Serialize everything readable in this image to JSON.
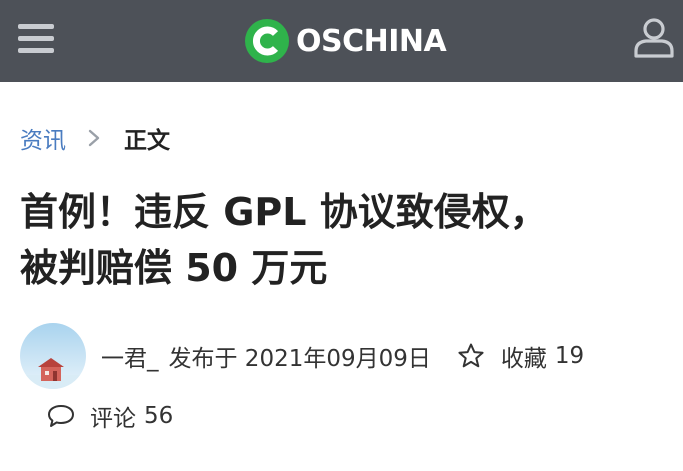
{
  "header": {
    "brand": "OSCHINA",
    "colors": {
      "bar": "#4d5158",
      "logo_green": "#2fb34b"
    },
    "icons": {
      "menu": "hamburger-menu-icon",
      "user": "user-icon",
      "logo": "oschina-logo-icon"
    }
  },
  "breadcrumb": {
    "parent": "资讯",
    "current": "正文",
    "separator_icon": "chevron-right-icon",
    "link_color": "#4a7cc0"
  },
  "article": {
    "title_line1": "首例！违反 GPL 协议致侵权，",
    "title_line2": "被判赔偿 50 万元",
    "author": "一君_",
    "published": "发布于 2021年09月09日",
    "favorites_label": "收藏",
    "favorites_count": "19",
    "comments_label": "评论",
    "comments_count": "56",
    "icons": {
      "favorite": "star-icon",
      "comment": "comment-bubble-icon",
      "avatar": "avatar-image"
    }
  }
}
